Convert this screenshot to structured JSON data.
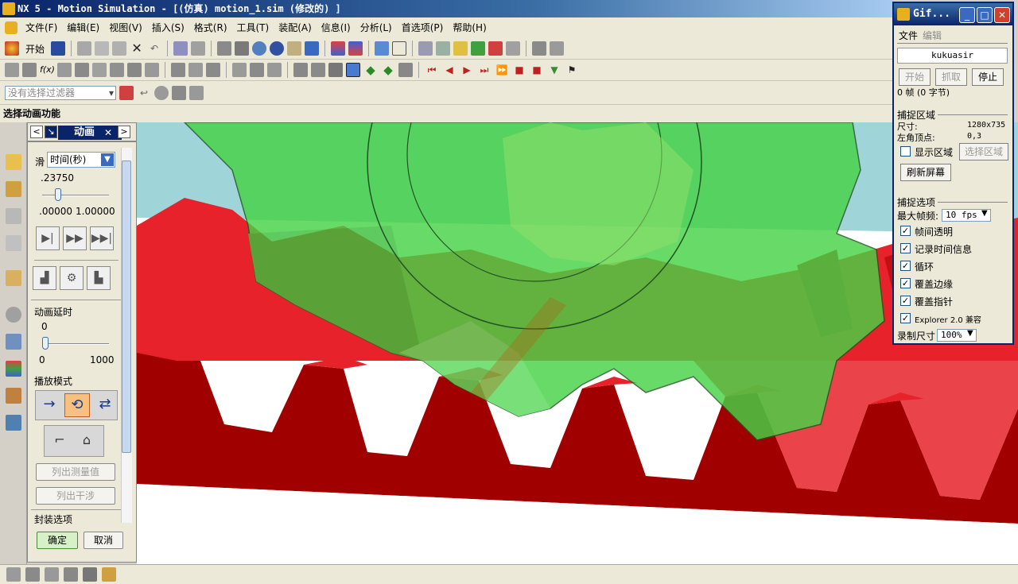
{
  "window": {
    "title": "NX 5 - Motion Simulation - [(仿真) motion_1.sim  (修改的) ]"
  },
  "menu": [
    "文件(F)",
    "编辑(E)",
    "视图(V)",
    "插入(S)",
    "格式(R)",
    "工具(T)",
    "装配(A)",
    "信息(I)",
    "分析(L)",
    "首选项(P)",
    "帮助(H)"
  ],
  "toolbar": {
    "start_label": "开始",
    "filter_placeholder": "没有选择过滤器"
  },
  "status": {
    "prompt": "选择动画功能"
  },
  "anim_panel": {
    "title": "动画",
    "slider_label": "滑",
    "time_mode": "时间(秒)",
    "current_time": ".23750",
    "time_min": ".00000",
    "time_max": "1.00000",
    "time_fraction": 0.2375,
    "delay_label": "动画延时",
    "delay_value": "0",
    "delay_min": "0",
    "delay_max": "1000",
    "play_mode_label": "播放模式",
    "list_measure": "列出测量值",
    "list_interference": "列出干涉",
    "envelope_label": "封装选项",
    "ok": "确定",
    "cancel": "取消"
  },
  "gif_window": {
    "title": "Gif...",
    "menu_file": "文件",
    "menu_edit": "编辑",
    "user": "kukuasir",
    "btn_start": "开始",
    "btn_capture": "抓取",
    "btn_stop": "停止",
    "frames_info": "0 帧  (0 字节)",
    "section_area": "捕捉区域",
    "size_label": "尺寸:",
    "size_value": "1280x735",
    "corner_label": "左角顶点:",
    "corner_value": "0,3",
    "show_area": "显示区域",
    "select_area": "选择区域",
    "refresh_screen": "刷新屏幕",
    "section_options": "捕捉选项",
    "max_fps_label": "最大帧频:",
    "max_fps_value": "10 fps",
    "options": [
      {
        "label": "帧间透明",
        "checked": true
      },
      {
        "label": "记录时间信息",
        "checked": true
      },
      {
        "label": "循环",
        "checked": true
      },
      {
        "label": "覆盖边缘",
        "checked": true
      },
      {
        "label": "覆盖指针",
        "checked": true
      },
      {
        "label": "Explorer 2.0 兼容",
        "checked": true
      }
    ],
    "record_size_label": "录制尺寸",
    "record_size_value": "100%"
  },
  "colors": {
    "rack": "#e8222a",
    "rack_dark": "#a10000",
    "gear": "#46d246",
    "sky": "#9fd4d8"
  }
}
